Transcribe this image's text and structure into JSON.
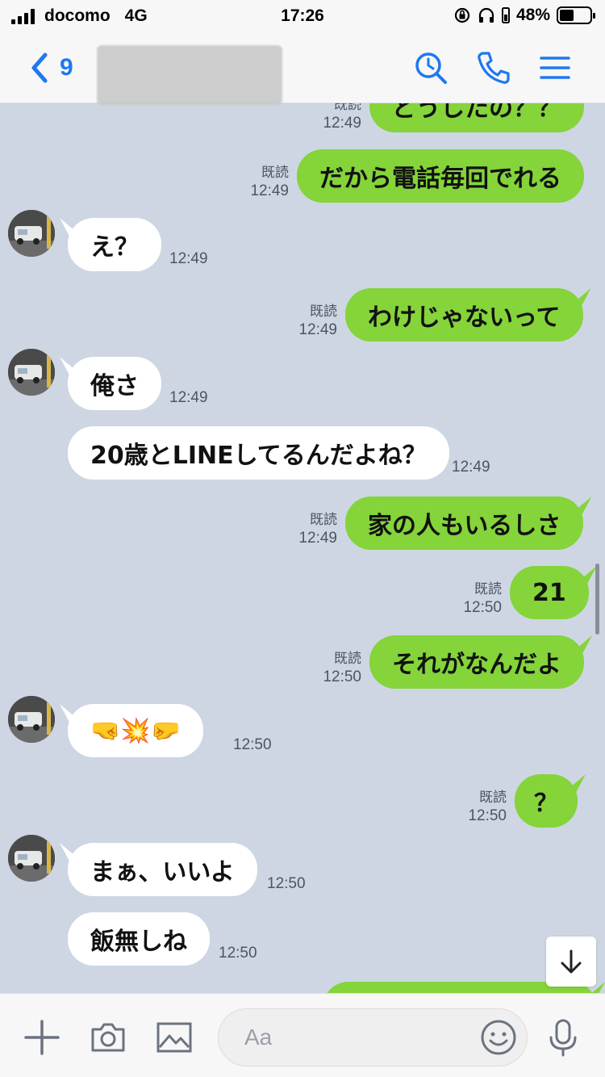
{
  "status_bar": {
    "carrier": "docomo",
    "network": "4G",
    "time": "17:26",
    "battery": "48%"
  },
  "header": {
    "contact_name": "9",
    "icons": [
      "search-history-icon",
      "phone-icon",
      "menu-icon"
    ],
    "accent_color": "#1e78f0"
  },
  "colors": {
    "background": "#ced6e3",
    "my_bubble": "#84d43a",
    "their_bubble": "#ffffff"
  },
  "messages": [
    {
      "sender": "me",
      "text": "どうしたの？？",
      "read": "既読",
      "time": "12:49"
    },
    {
      "sender": "me",
      "text": "だから電話毎回でれる",
      "read": "既読",
      "time": "12:49"
    },
    {
      "sender": "them",
      "text": "え？",
      "time": "12:49"
    },
    {
      "sender": "me",
      "text": "わけじゃないって",
      "read": "既読",
      "time": "12:49"
    },
    {
      "sender": "them",
      "text": "俺さ",
      "time": "12:49"
    },
    {
      "sender": "them",
      "text": "20歳とLINEしてるんだよね？",
      "time": "12:49"
    },
    {
      "sender": "me",
      "text": "家の人もいるしさ",
      "read": "既読",
      "time": "12:49"
    },
    {
      "sender": "me",
      "text": "21",
      "read": "既読",
      "time": "12:50"
    },
    {
      "sender": "me",
      "text": "それがなんだよ",
      "read": "既読",
      "time": "12:50"
    },
    {
      "sender": "them",
      "text": "🤜💥🤛",
      "time": "12:50"
    },
    {
      "sender": "me",
      "text": "？",
      "read": "既読",
      "time": "12:50"
    },
    {
      "sender": "them",
      "text": "まぁ、いいよ",
      "time": "12:50"
    },
    {
      "sender": "them",
      "text": "飯無しね",
      "time": "12:50"
    }
  ],
  "input": {
    "placeholder": "Aa"
  }
}
